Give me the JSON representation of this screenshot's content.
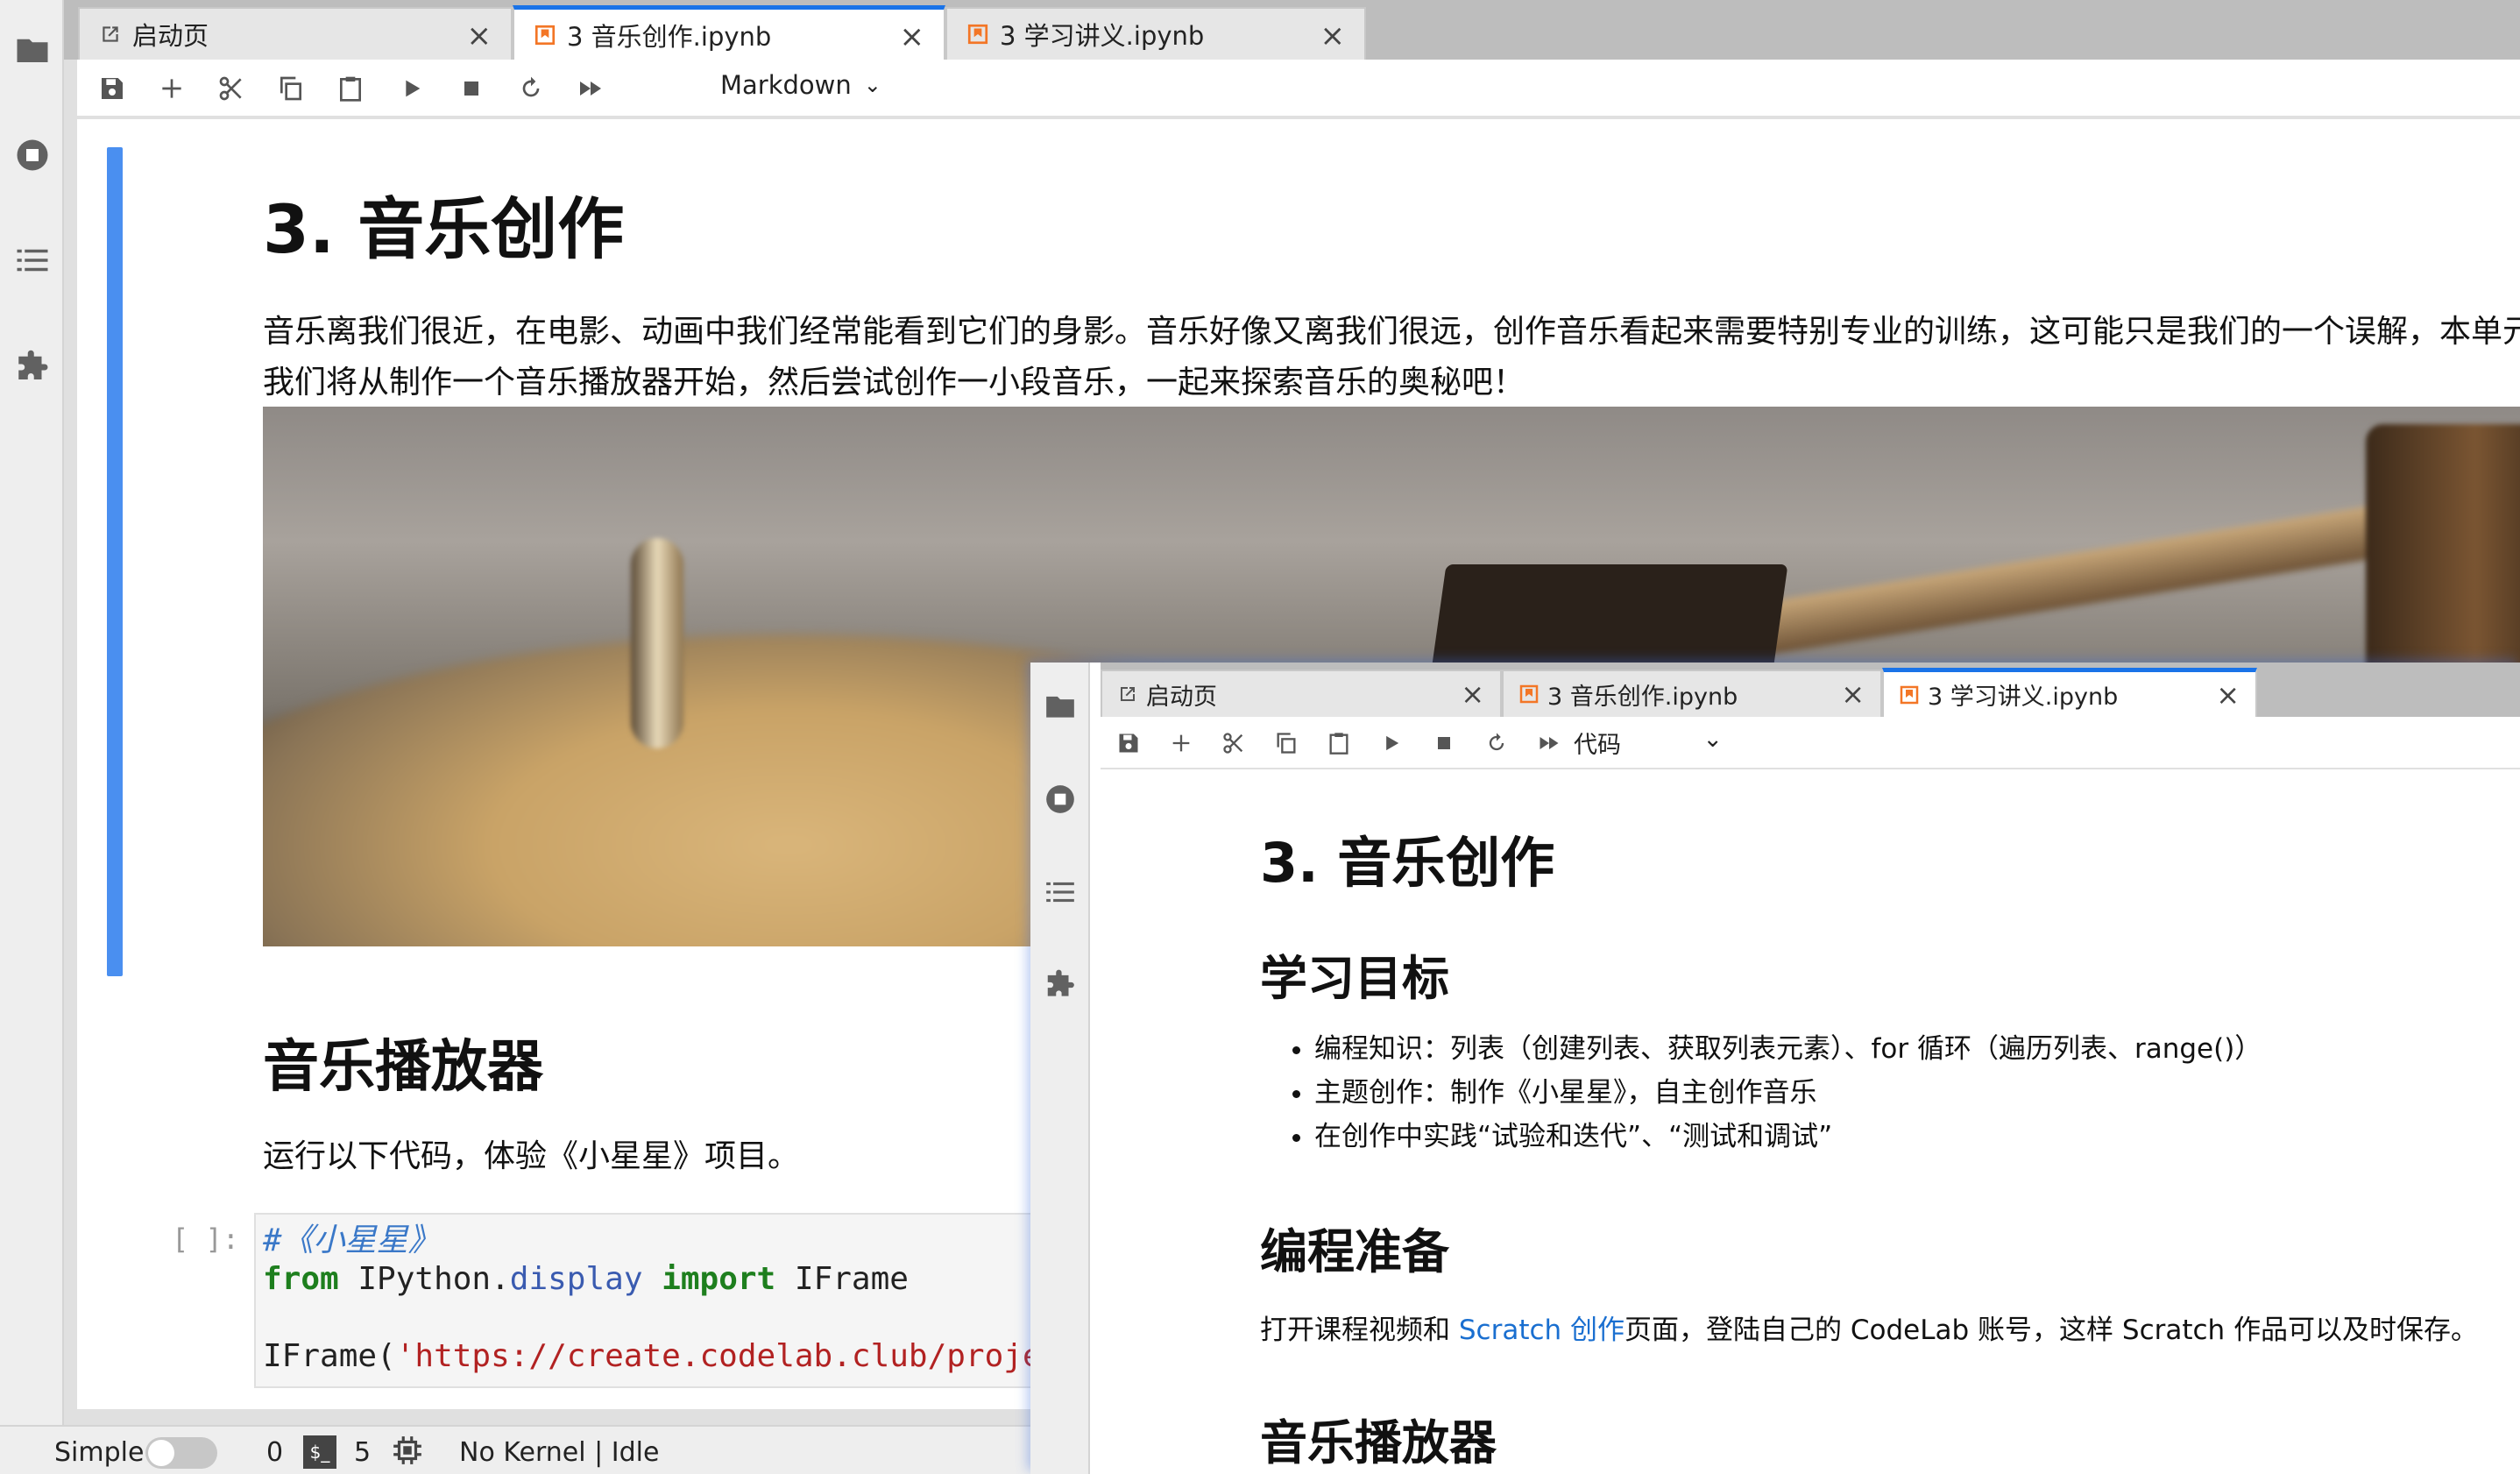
{
  "main": {
    "tabs": [
      {
        "label": "启动页",
        "icon": "launcher-icon"
      },
      {
        "label": "3 音乐创作.ipynb",
        "icon": "notebook-icon"
      },
      {
        "label": "3 学习讲义.ipynb",
        "icon": "notebook-icon"
      }
    ],
    "toolbar": {
      "cell_type": "Markdown"
    },
    "notebook": {
      "title": "3. 音乐创作",
      "intro": "音乐离我们很近，在电影、动画中我们经常能看到它们的身影。音乐好像又离我们很远，创作音乐看起来需要特别专业的训练，这可能只是我们的一个误解，本单元我们将从制作一个音乐播放器开始，然后尝试创作一小段音乐，一起来探索音乐的奥秘吧！",
      "section_title": "音乐播放器",
      "section_text": "运行以下代码，体验《小星星》项目。",
      "prompt": "[ ]:",
      "code": {
        "comment": "#《小星星》",
        "kw_from": "from",
        "mod_ipython": " IPython.",
        "mod_display": "display",
        "kw_import": "import",
        "name_iframe": " IFrame",
        "call": "IFrame(",
        "url": "'https://create.codelab.club/projects/"
      }
    },
    "status": {
      "mode": "Simple",
      "terminals": "0",
      "kernels": "5",
      "kernel_state": "No Kernel | Idle"
    }
  },
  "second_window": {
    "tabs": [
      {
        "label": "启动页",
        "icon": "launcher-icon"
      },
      {
        "label": "3 音乐创作.ipynb",
        "icon": "notebook-icon"
      },
      {
        "label": "3 学习讲义.ipynb",
        "icon": "notebook-icon"
      }
    ],
    "toolbar": {
      "cell_type": "代码"
    },
    "content": {
      "title": "3. 音乐创作",
      "goals_title": "学习目标",
      "goals": [
        "编程知识：列表（创建列表、获取列表元素）、for 循环（遍历列表、range()）",
        "主题创作：制作《小星星》，自主创作音乐",
        "在创作中实践“试验和迭代”、“测试和调试”"
      ],
      "prep_title": "编程准备",
      "prep_text_before": "打开课程视频和 ",
      "prep_link": "Scratch 创作",
      "prep_text_after": "页面，登陆自己的 CodeLab 账号，这样 Scratch 作品可以及时保存。",
      "player_title": "音乐播放器"
    }
  },
  "colors": {
    "accent": "#1a73e8",
    "cell_bar": "#4a8ff0",
    "notebook_icon": "#f37626"
  }
}
